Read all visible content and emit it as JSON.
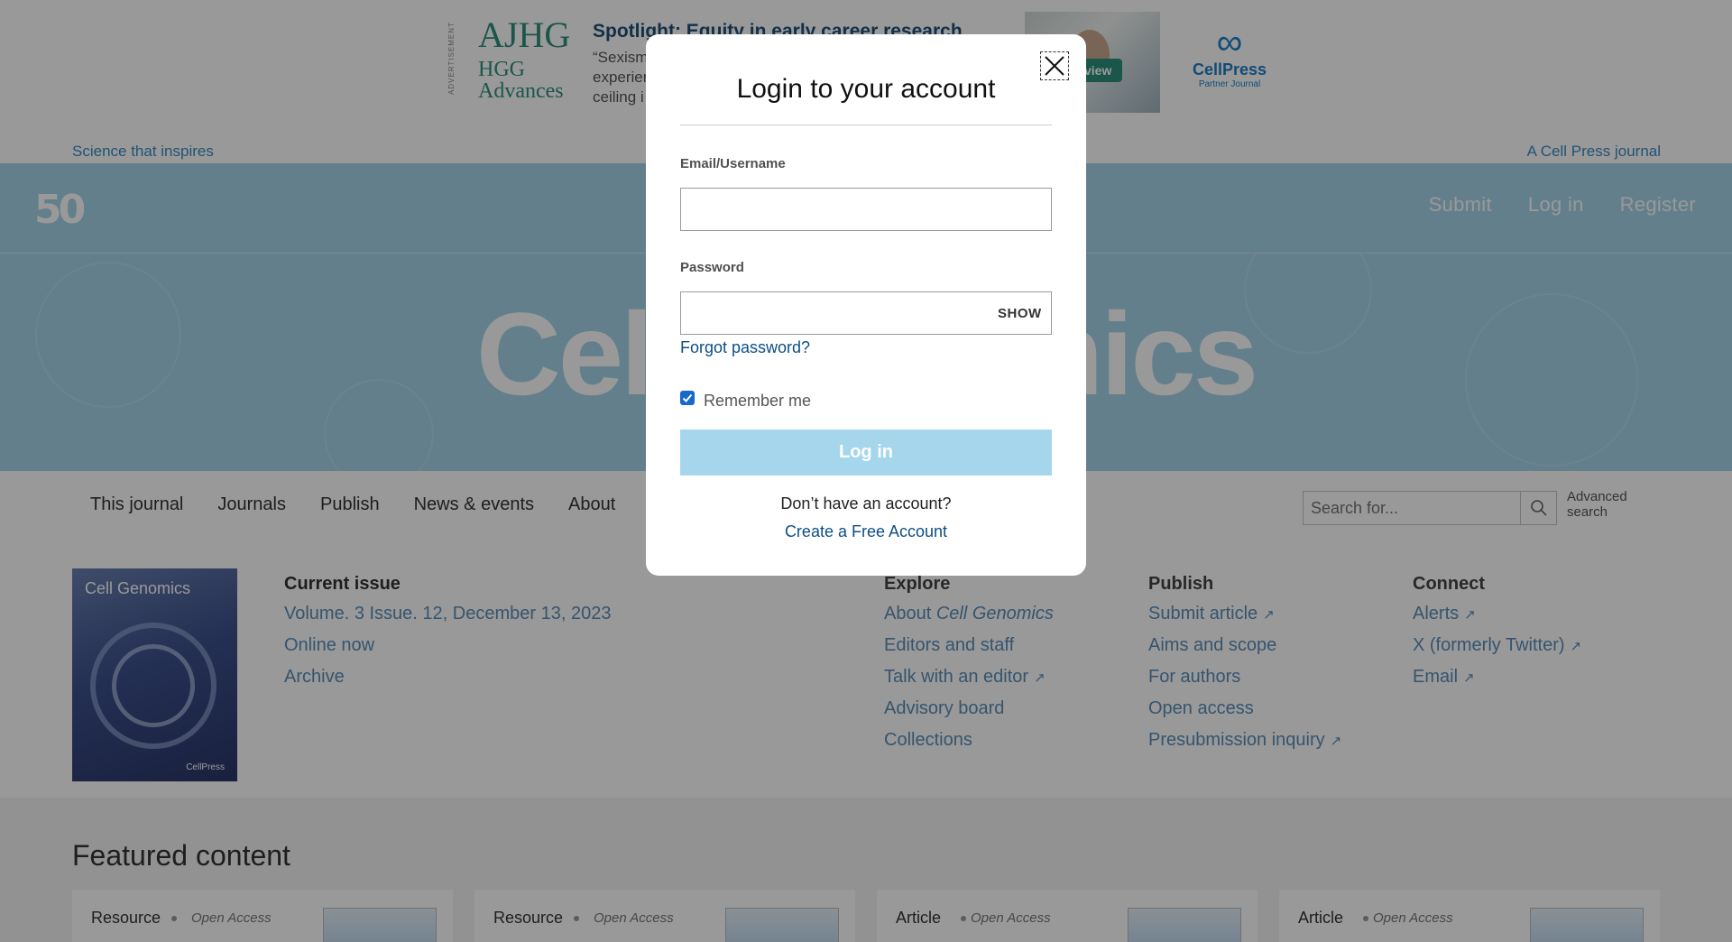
{
  "ad": {
    "tag": "ADVERTISEMENT",
    "logo_line1": "AJHG",
    "logo_line2": "HGG",
    "logo_line3": "Advances",
    "title": "Spotlight: Equity in early career research",
    "body": "“Sexism experienced ceiling i",
    "preview_label": "view",
    "partner_name": "CellPress",
    "partner_sub": "Partner Journal"
  },
  "tagline": "Science that inspires",
  "journal_of": "A Cell Press journal",
  "header": {
    "logo": "50",
    "nav": [
      "Submit",
      "Log in",
      "Register"
    ]
  },
  "hero_title": "Cell Genomics",
  "subnav": {
    "items": [
      "This journal",
      "Journals",
      "Publish",
      "News & events",
      "About"
    ],
    "search_placeholder": "Search for...",
    "advanced_line1": "Advanced",
    "advanced_line2": "search"
  },
  "cover": {
    "title": "Cell Genomics",
    "publisher": "CellPress"
  },
  "issue": {
    "heading": "Current issue",
    "volume": "Volume. 3 Issue. 12, December 13, 2023",
    "online": "Online now",
    "archive": "Archive"
  },
  "explore": {
    "heading": "Explore",
    "about_prefix": "About ",
    "about_italic": "Cell Genomics",
    "items": [
      "Editors and staff",
      "Talk with an editor",
      "Advisory board",
      "Collections"
    ]
  },
  "publish": {
    "heading": "Publish",
    "items": [
      "Submit article",
      "Aims and scope",
      "For authors",
      "Open access",
      "Presubmission inquiry"
    ]
  },
  "connect": {
    "heading": "Connect",
    "items": [
      "Alerts",
      "X (formerly Twitter)",
      "Email"
    ]
  },
  "external_glyph": "↗",
  "featured": {
    "title": "Featured content",
    "cards": [
      {
        "type": "Resource",
        "access": "Open Access"
      },
      {
        "type": "Resource",
        "access": "Open Access"
      },
      {
        "type": "Article",
        "access": "Open Access"
      },
      {
        "type": "Article",
        "access": "Open Access"
      }
    ]
  },
  "modal": {
    "title": "Login to your account",
    "email_label": "Email/Username",
    "email_value": "",
    "password_label": "Password",
    "password_value": "",
    "show_label": "SHOW",
    "forgot_label": "Forgot password?",
    "remember_label": "Remember me",
    "remember_checked": true,
    "login_label": "Log in",
    "no_account": "Don’t have an account?",
    "create_label": "Create a Free Account"
  },
  "colors": {
    "brand_blue": "#a5d4ea",
    "link_blue": "#0d4f86",
    "checkbox_blue": "#1668c9"
  },
  "icons": {
    "close": "close-icon",
    "search": "search-icon",
    "checkbox": "check-icon"
  }
}
